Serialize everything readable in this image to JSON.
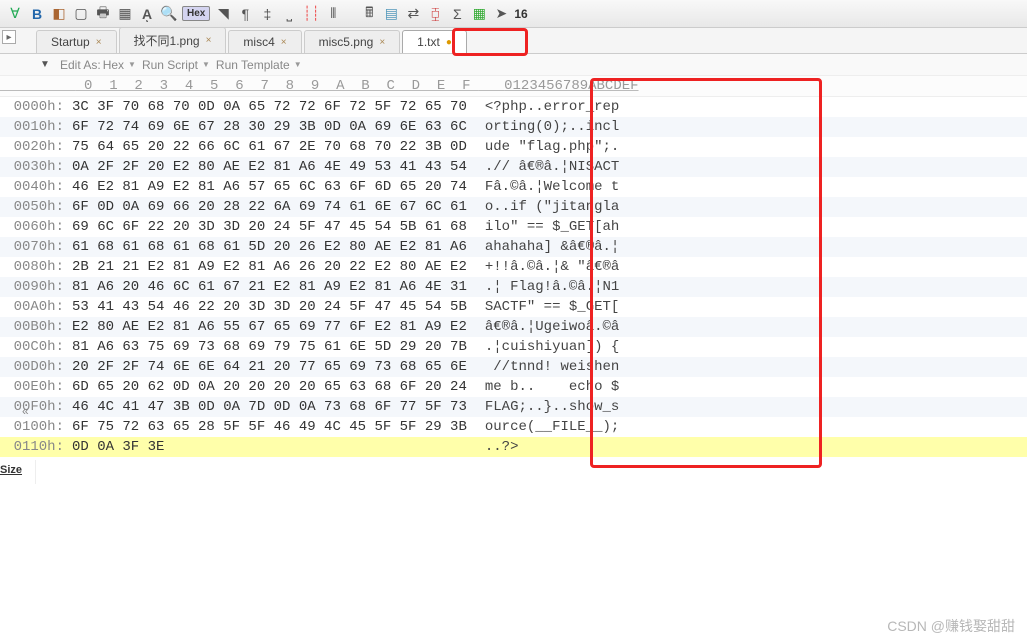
{
  "toolbar": {
    "hex_label": "Hex",
    "num16": "16"
  },
  "tabs": [
    {
      "label": "Startup",
      "close": "×"
    },
    {
      "label": "找不同1.png",
      "close": "×"
    },
    {
      "label": "misc4",
      "close": "×"
    },
    {
      "label": "misc5.png",
      "close": "×"
    },
    {
      "label": "1.txt",
      "close": "●"
    }
  ],
  "scriptbar": {
    "edit_as": "Edit As:",
    "hex": "Hex",
    "run_script": "Run Script",
    "run_template": "Run Template"
  },
  "header": {
    "offsets_pad": "         ",
    "hex_cols": " 0  1  2  3  4  5  6  7  8  9  A  B  C  D  E  F ",
    "ascii_cols": "0123456789ABCDEF"
  },
  "rows": [
    {
      "o": "0000h:",
      "h": "3C 3F 70 68 70 0D 0A 65 72 72 6F 72 5F 72 65 70",
      "a": "<?php..error_rep"
    },
    {
      "o": "0010h:",
      "h": "6F 72 74 69 6E 67 28 30 29 3B 0D 0A 69 6E 63 6C",
      "a": "orting(0);..incl"
    },
    {
      "o": "0020h:",
      "h": "75 64 65 20 22 66 6C 61 67 2E 70 68 70 22 3B 0D",
      "a": "ude \"flag.php\";."
    },
    {
      "o": "0030h:",
      "h": "0A 2F 2F 20 E2 80 AE E2 81 A6 4E 49 53 41 43 54",
      "a": ".// â€®â.¦NISACT"
    },
    {
      "o": "0040h:",
      "h": "46 E2 81 A9 E2 81 A6 57 65 6C 63 6F 6D 65 20 74",
      "a": "Fâ.©â.¦Welcome t"
    },
    {
      "o": "0050h:",
      "h": "6F 0D 0A 69 66 20 28 22 6A 69 74 61 6E 67 6C 61",
      "a": "o..if (\"jitangla"
    },
    {
      "o": "0060h:",
      "h": "69 6C 6F 22 20 3D 3D 20 24 5F 47 45 54 5B 61 68",
      "a": "ilo\" == $_GET[ah"
    },
    {
      "o": "0070h:",
      "h": "61 68 61 68 61 68 61 5D 20 26 E2 80 AE E2 81 A6",
      "a": "ahahaha] &â€®â.¦"
    },
    {
      "o": "0080h:",
      "h": "2B 21 21 E2 81 A9 E2 81 A6 26 20 22 E2 80 AE E2",
      "a": "+!!â.©â.¦& \"â€®â"
    },
    {
      "o": "0090h:",
      "h": "81 A6 20 46 6C 61 67 21 E2 81 A9 E2 81 A6 4E 31",
      "a": ".¦ Flag!â.©â.¦N1"
    },
    {
      "o": "00A0h:",
      "h": "53 41 43 54 46 22 20 3D 3D 20 24 5F 47 45 54 5B",
      "a": "SACTF\" == $_GET["
    },
    {
      "o": "00B0h:",
      "h": "E2 80 AE E2 81 A6 55 67 65 69 77 6F E2 81 A9 E2",
      "a": "â€®â.¦Ugeiwoâ.©â"
    },
    {
      "o": "00C0h:",
      "h": "81 A6 63 75 69 73 68 69 79 75 61 6E 5D 29 20 7B",
      "a": ".¦cuishiyuan]) {"
    },
    {
      "o": "00D0h:",
      "h": "20 2F 2F 74 6E 6E 64 21 20 77 65 69 73 68 65 6E",
      "a": " //tnnd! weishen"
    },
    {
      "o": "00E0h:",
      "h": "6D 65 20 62 0D 0A 20 20 20 20 65 63 68 6F 20 24",
      "a": "me b..    echo $"
    },
    {
      "o": "00F0h:",
      "h": "46 4C 41 47 3B 0D 0A 7D 0D 0A 73 68 6F 77 5F 73",
      "a": "FLAG;..}..show_s"
    },
    {
      "o": "0100h:",
      "h": "6F 75 72 63 65 28 5F 5F 46 49 4C 45 5F 5F 29 3B",
      "a": "ource(__FILE__);"
    },
    {
      "o": "0110h:",
      "h": "0D 0A 3F 3E                                    ",
      "a": "..?>"
    }
  ],
  "side_panel": {
    "header": "Size"
  },
  "watermark": "CSDN @赚钱娶甜甜"
}
